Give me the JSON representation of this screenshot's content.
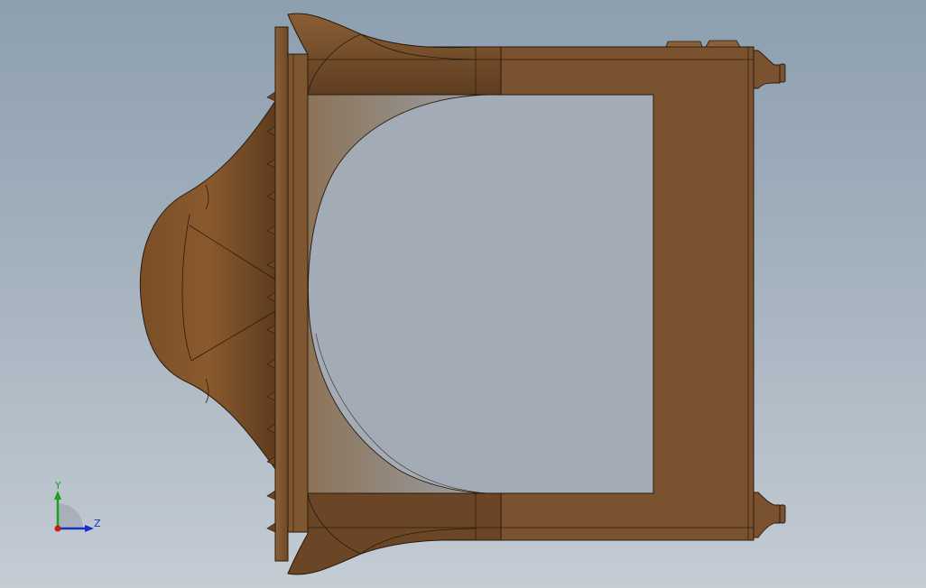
{
  "viewport": {
    "name": "cad-graphics-area",
    "background_top": "#8d9fb0",
    "background_bottom": "#c4ccd4"
  },
  "model": {
    "material_color": "#7a5230",
    "material_light": "#9a6a3e",
    "material_dark": "#5e3d20",
    "edge_color": "#2a1a0c"
  },
  "triad": {
    "y_label": "Y",
    "z_label": "Z",
    "y_color": "#1aa31a",
    "z_color": "#1a2fc8",
    "origin_color": "#c81a1a"
  }
}
